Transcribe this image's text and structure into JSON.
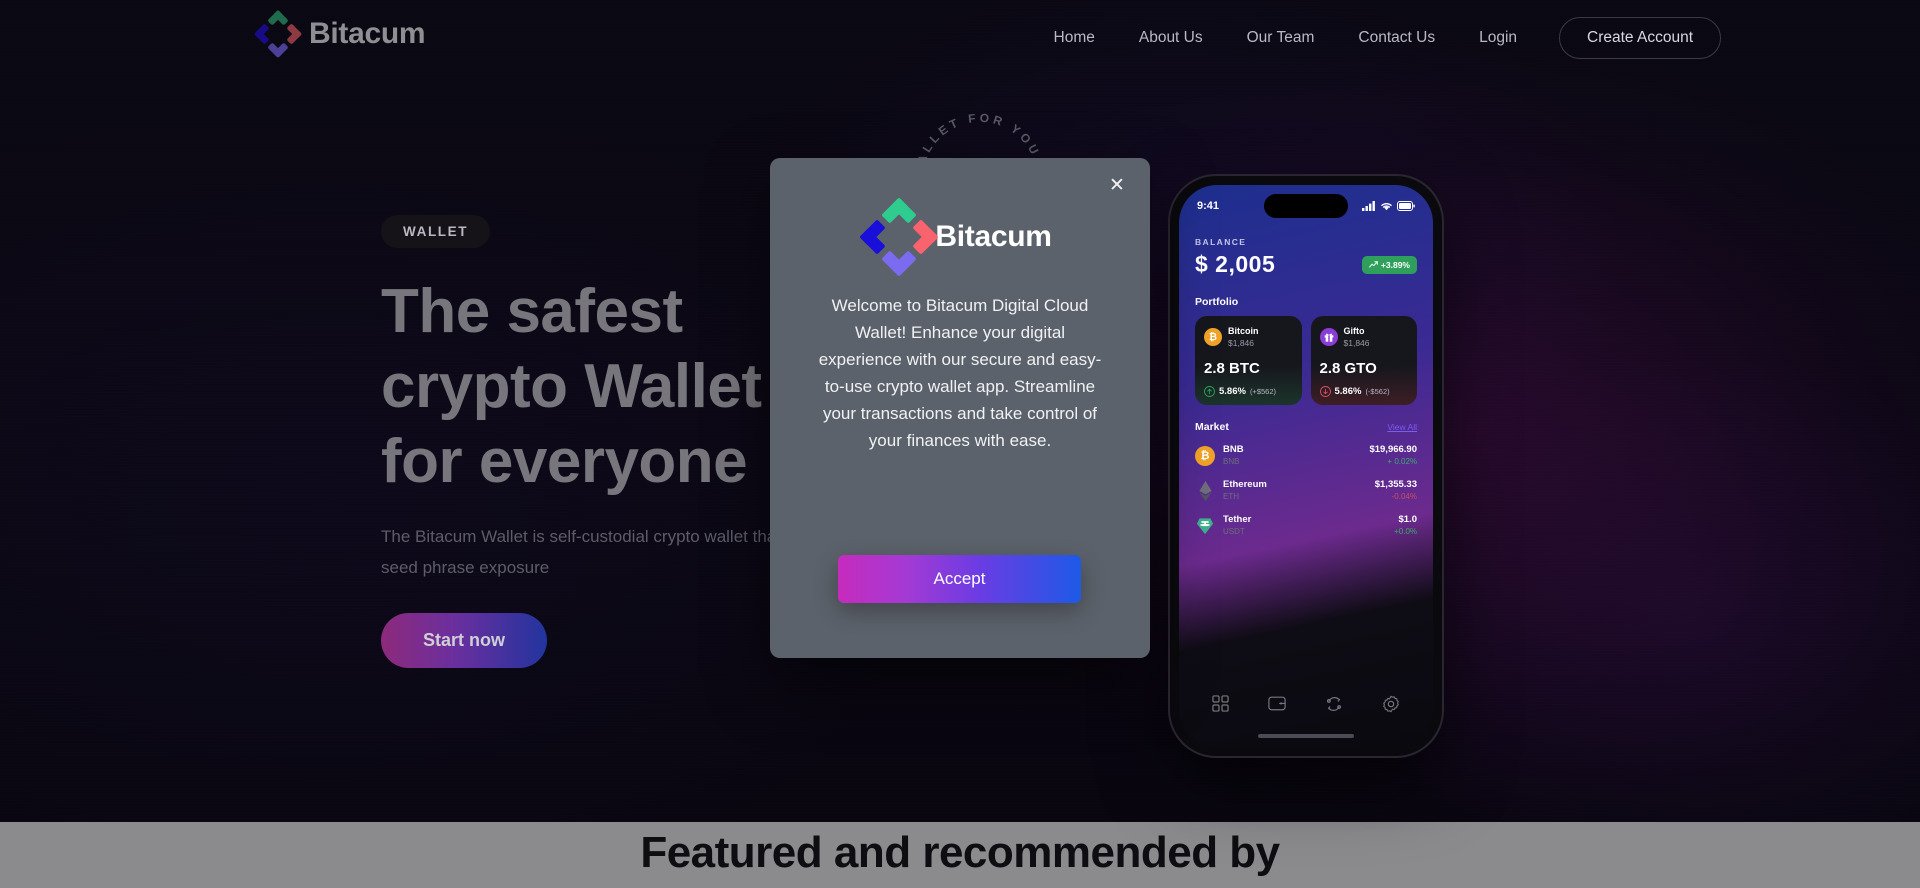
{
  "brand": {
    "name": "Bitacum",
    "logo_icon": "bitacum-puzzle-logo"
  },
  "nav": {
    "links": [
      {
        "label": "Home"
      },
      {
        "label": "About Us"
      },
      {
        "label": "Our Team"
      },
      {
        "label": "Contact Us"
      },
      {
        "label": "Login"
      }
    ],
    "cta_label": "Create Account"
  },
  "hero": {
    "chip": "WALLET",
    "title_lines": [
      "The safest",
      "crypto Wallet",
      "for everyone"
    ],
    "subtitle": "The Bitacum Wallet is self-custodial crypto wallet that eliminates risk of seed phrase exposure",
    "cta_label": "Start now",
    "circular_badge_text": "WALLET FOR YOU  •  WALLET FOR YOU  •  "
  },
  "phone": {
    "status": {
      "time": "9:41",
      "signal_icon": "cellular-icon",
      "wifi_icon": "wifi-icon",
      "battery_icon": "battery-icon"
    },
    "balance": {
      "label": "BALANCE",
      "amount": "$ 2,005",
      "change": "+3.89%",
      "change_icon": "trend-up-icon",
      "change_color": "#2ea05c"
    },
    "portfolio": {
      "title": "Portfolio",
      "cards": [
        {
          "name": "Bitcoin",
          "price": "$1,846",
          "qty": "2.8 BTC",
          "pct": "5.86%",
          "amount": "(+$562)",
          "color": "#f0a328",
          "tone": "green",
          "icon": "bitcoin-icon",
          "symbol": "₿"
        },
        {
          "name": "Gifto",
          "price": "$1,846",
          "qty": "2.8 GTO",
          "pct": "5.86%",
          "amount": "(-$562)",
          "color": "#8b3bd6",
          "tone": "red",
          "icon": "gift-icon",
          "symbol": "🎁"
        }
      ]
    },
    "market": {
      "title": "Market",
      "view_all": "View All",
      "rows": [
        {
          "name": "BNB",
          "symbol": "BNB",
          "price": "$19,966.90",
          "change": "+ 0.02%",
          "dir": "up",
          "icon": "bnb-icon",
          "color": "#f0a328"
        },
        {
          "name": "Ethereum",
          "symbol": "ETH",
          "price": "$1,355.33",
          "change": "-0.04%",
          "dir": "down",
          "icon": "ethereum-icon",
          "color": "#8a8a96"
        },
        {
          "name": "Tether",
          "symbol": "USDT",
          "price": "$1.0",
          "change": "+0.0%",
          "dir": "up",
          "icon": "tether-icon",
          "color": "#3fb08f"
        }
      ]
    },
    "tabs": [
      {
        "icon": "grid-dashboard-icon"
      },
      {
        "icon": "wallet-icon"
      },
      {
        "icon": "swap-icon"
      },
      {
        "icon": "settings-gear-icon"
      }
    ]
  },
  "featured_section": {
    "heading": "Featured and recommended by"
  },
  "modal": {
    "close_icon": "close-icon",
    "logo_icon": "bitacum-puzzle-logo",
    "title": "Bitacum",
    "body": "Welcome to Bitacum Digital Cloud Wallet! Enhance your digital experience with our secure and easy-to-use crypto wallet app. Streamline your transactions and take control of your finances with ease.",
    "accept_label": "Accept"
  },
  "colors": {
    "logo_green": "#2ecc8f",
    "logo_red": "#f9636e",
    "logo_blue": "#1a0fd9",
    "logo_purple": "#7b6bf0",
    "accent_gradient_from": "#c62bbd",
    "accent_gradient_to": "#1d5ae6",
    "modal_bg": "#5c626b",
    "page_bg": "#09070f"
  }
}
